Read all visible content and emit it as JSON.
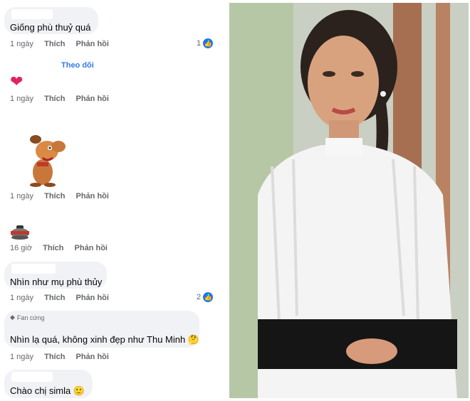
{
  "comments": [
    {
      "text": "Giống phù thuỷ quá",
      "time": "1 ngày",
      "like": "Thích",
      "reply": "Phản hồi",
      "reactions": "1"
    },
    {
      "follow": "Theo dõi",
      "time": "1 ngày",
      "like": "Thích",
      "reply": "Phản hồi"
    },
    {
      "time": "1 ngày",
      "like": "Thích",
      "reply": "Phản hồi"
    },
    {
      "time": "16 giờ",
      "like": "Thích",
      "reply": "Phản hồi"
    },
    {
      "text": "Nhìn như mụ phù thủy",
      "time": "1 ngày",
      "like": "Thích",
      "reply": "Phản hồi",
      "reactions": "2"
    },
    {
      "badge": "Fan cứng",
      "text": "Nhìn lạ quá, không xinh đẹp như Thu Minh 🤔",
      "time": "1 ngày",
      "like": "Thích",
      "reply": "Phản hồi"
    },
    {
      "text": "Chào chị simla 🙂"
    }
  ],
  "icons": {
    "like": "thumbs-up-icon",
    "heart": "heart-emoji-icon",
    "sticker": "dog-sticker-icon",
    "curling": "curling-stone-emoji-icon",
    "fan": "diamond-icon"
  },
  "colors": {
    "bubble": "#f0f2f5",
    "link": "#3578e5",
    "meta": "#65676b",
    "like": "#1877f2"
  }
}
